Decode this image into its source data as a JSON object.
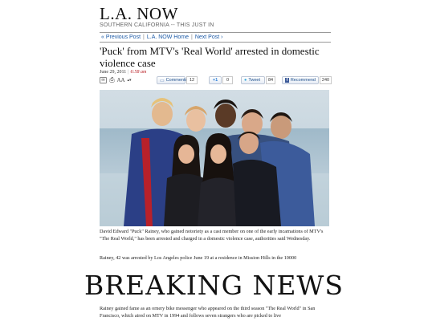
{
  "blog": {
    "title": "L.A. NOW",
    "subtitle": "SOUTHERN CALIFORNIA -- THIS JUST IN"
  },
  "nav": {
    "prev": "« Previous Post",
    "home": "L.A. NOW Home",
    "next": "Next Post ›",
    "separator": "|"
  },
  "article": {
    "headline": "'Puck' from MTV's 'Real World' arrested in domestic violence case",
    "date": "June 29, 2011",
    "time": "6:58 am",
    "caption": "David Edward \"Puck\" Rainey, who gained notoriety as a cast member on one of the early incarnations of MTV's \"The Real World,\" has been arrested and charged in a domestic violence case, authorities said Wednesday.",
    "paragraph2": "Rainey, 42 was arrested by Los Angeles police June 19 at a residence in Mission Hills in the 10000",
    "breaking": "BREAKING NEWS",
    "paragraph3": "Rainey gained fame as an ornery bike messenger who appeared on the third season \"The Real World\" in San Francisco, which aired on MTV in 1994 and follows seven strangers who are picked to live"
  },
  "toolbar": {
    "font_label": "AA",
    "comments_label": "Comments",
    "comments_count": "12",
    "gplus_label": "+1",
    "gplus_count": "0",
    "tweet_label": "Tweet",
    "tweet_count": "84",
    "recommend_label": "Recommend",
    "recommend_count": "240"
  },
  "colors": {
    "link": "#1c5aa6",
    "time": "#b5151b",
    "facebook": "#3b5998"
  }
}
